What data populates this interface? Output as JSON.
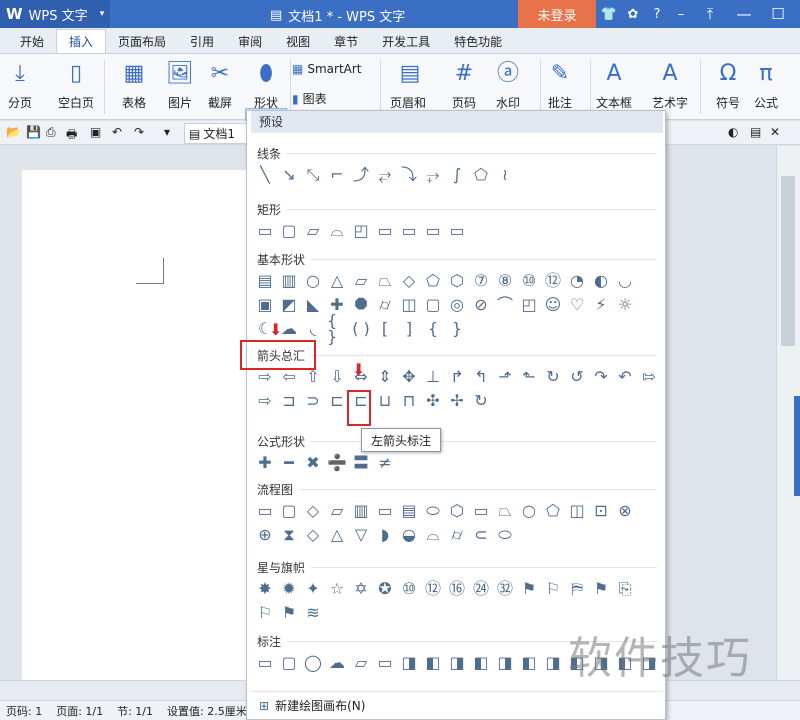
{
  "app": {
    "logo": "W",
    "name": "WPS 文字",
    "dropdown": "▾"
  },
  "window": {
    "title": "文档1 * - WPS 文字",
    "login": "未登录"
  },
  "title_icons": [
    "shirt-icon",
    "chat-icon",
    "help-icon",
    "minimize-icon",
    "restore-icon",
    "close-icon"
  ],
  "title_icon_glyphs": {
    "shirt": "👕",
    "chat": "✿",
    "help": "?",
    "dash": "–",
    "upload": "⤒",
    "min": "—",
    "max": "☐",
    "close": "✕"
  },
  "menu": {
    "tabs": [
      "开始",
      "插入",
      "页面布局",
      "引用",
      "审阅",
      "视图",
      "章节",
      "开发工具",
      "特色功能"
    ],
    "active": "插入"
  },
  "ribbon": {
    "items": [
      {
        "label": "分页",
        "icon": "page-break-icon"
      },
      {
        "label": "空白页",
        "icon": "blank-page-icon"
      },
      {
        "label": "表格",
        "icon": "table-icon"
      },
      {
        "label": "图片",
        "icon": "picture-icon"
      },
      {
        "label": "截屏",
        "icon": "screenshot-icon"
      },
      {
        "label": "形状",
        "icon": "shapes-icon"
      },
      {
        "label": "页眉和页脚",
        "icon": "header-footer-icon"
      },
      {
        "label": "页码",
        "icon": "page-number-icon"
      },
      {
        "label": "水印",
        "icon": "watermark-icon"
      },
      {
        "label": "批注",
        "icon": "comment-icon"
      },
      {
        "label": "文本框",
        "icon": "textbox-icon"
      },
      {
        "label": "艺术字",
        "icon": "wordart-icon"
      },
      {
        "label": "符号",
        "icon": "symbol-icon"
      },
      {
        "label": "公式",
        "icon": "formula-icon"
      }
    ],
    "smartart": "SmartArt",
    "chart": "图表",
    "dropdown": "▾"
  },
  "quickbar": {
    "doc_tab": "文档1"
  },
  "shapes_panel": {
    "header": "预设",
    "sections": [
      {
        "name": "线条",
        "rows": [
          [
            "╲",
            "↘",
            "⤡",
            "⌐",
            "⤴",
            "⥂",
            "⤵",
            "⥅",
            "∫",
            "⬠",
            "≀"
          ]
        ]
      },
      {
        "name": "矩形",
        "rows": [
          [
            "▭",
            "▢",
            "▱",
            "⌓",
            "◰",
            "▭",
            "▭",
            "▭",
            "▭"
          ]
        ]
      },
      {
        "name": "基本形状",
        "rows": [
          [
            "▤",
            "▥",
            "○",
            "△",
            "▱",
            "⏢",
            "◇",
            "⬠",
            "⬡",
            "⑦",
            "⑧",
            "⑩",
            "⑫",
            "◔",
            "◐",
            "◡"
          ],
          [
            "▣",
            "◩",
            "◣",
            "✚",
            "⯃",
            "⌭",
            "◫",
            "▢",
            "◎",
            "⊘",
            "⌒",
            "◰",
            "☺",
            "♡",
            "⚡",
            "☼"
          ],
          [
            "☾",
            "☁",
            "◟",
            "{ }",
            "( )",
            "[",
            "]",
            "{",
            "}"
          ]
        ]
      },
      {
        "name": "箭头总汇",
        "rows": [
          [
            "⇨",
            "⇦",
            "⇧",
            "⇩",
            "⇔",
            "⇕",
            "✥",
            "⊥",
            "↱",
            "↰",
            "⬏",
            "⬑",
            "↻",
            "↺",
            "↷",
            "↶",
            "⇰"
          ],
          [
            "⇨",
            "⊐",
            "⊃",
            "⊏",
            "⊏",
            "⊔",
            "⊓",
            "✣",
            "✢",
            "↻"
          ]
        ]
      },
      {
        "name": "公式形状",
        "rows": [
          [
            "✚",
            "━",
            "✖",
            "➗",
            "〓",
            "≠"
          ]
        ]
      },
      {
        "name": "流程图",
        "rows": [
          [
            "▭",
            "▢",
            "◇",
            "▱",
            "▥",
            "▭",
            "▤",
            "⬭",
            "⬡",
            "▭",
            "⏢",
            "○",
            "⬠",
            "◫",
            "⊡",
            "⊗"
          ],
          [
            "⊕",
            "⧗",
            "◇",
            "△",
            "▽",
            "◗",
            "◒",
            "⌓",
            "⌭",
            "⊂",
            "⬭"
          ]
        ]
      },
      {
        "name": "星与旗帜",
        "rows": [
          [
            "✸",
            "✹",
            "✦",
            "☆",
            "✡",
            "✪",
            "⑩",
            "⑫",
            "⑯",
            "㉔",
            "㉜",
            "⚑",
            "⚐",
            "⛿",
            "⚑",
            "⎘"
          ],
          [
            "⚐",
            "⚑",
            "≋"
          ]
        ]
      },
      {
        "name": "标注",
        "rows": [
          [
            "▭",
            "▢",
            "◯",
            "☁",
            "▱",
            "▭",
            "◨",
            "◧",
            "◨",
            "◧",
            "◨",
            "◧",
            "◨",
            "◧",
            "◨",
            "◧",
            "◨"
          ]
        ]
      }
    ],
    "footer": "新建绘图画布(N)",
    "tooltip": "左箭头标注"
  },
  "status": {
    "page_code": "页码: 1",
    "page": "页面: 1/1",
    "section": "节: 1/1",
    "setting": "设置值: 2.5厘米"
  },
  "watermark": "软件技巧",
  "colors": {
    "titlebar": "#3a6fc4",
    "login": "#e8734a",
    "highlight": "#d92626",
    "shape_stroke": "#4f6d8f"
  }
}
